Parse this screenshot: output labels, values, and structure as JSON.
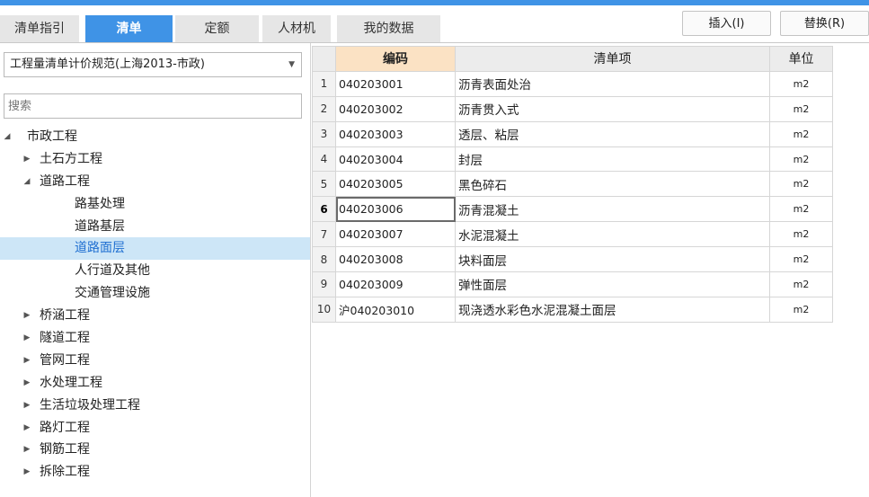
{
  "tabs": [
    "清单指引",
    "清单",
    "定额",
    "人材机",
    "我的数据"
  ],
  "active_tab": "清单",
  "buttons": {
    "insert": "插入(I)",
    "replace": "替换(R)"
  },
  "spec_select": {
    "value": "工程量清单计价规范(上海2013-市政)"
  },
  "search": {
    "placeholder": "搜索"
  },
  "tree": [
    {
      "label": "市政工程",
      "level": 0,
      "state": "expanded"
    },
    {
      "label": "土石方工程",
      "level": 1,
      "state": "collapsed"
    },
    {
      "label": "道路工程",
      "level": 1,
      "state": "expanded"
    },
    {
      "label": "路基处理",
      "level": 2,
      "state": "leaf"
    },
    {
      "label": "道路基层",
      "level": 2,
      "state": "leaf"
    },
    {
      "label": "道路面层",
      "level": 2,
      "state": "leaf",
      "selected": true
    },
    {
      "label": "人行道及其他",
      "level": 2,
      "state": "leaf"
    },
    {
      "label": "交通管理设施",
      "level": 2,
      "state": "leaf"
    },
    {
      "label": "桥涵工程",
      "level": 1,
      "state": "collapsed"
    },
    {
      "label": "隧道工程",
      "level": 1,
      "state": "collapsed"
    },
    {
      "label": "管网工程",
      "level": 1,
      "state": "collapsed"
    },
    {
      "label": "水处理工程",
      "level": 1,
      "state": "collapsed"
    },
    {
      "label": "生活垃圾处理工程",
      "level": 1,
      "state": "collapsed"
    },
    {
      "label": "路灯工程",
      "level": 1,
      "state": "collapsed"
    },
    {
      "label": "钢筋工程",
      "level": 1,
      "state": "collapsed"
    },
    {
      "label": "拆除工程",
      "level": 1,
      "state": "collapsed"
    }
  ],
  "table": {
    "headers": {
      "code": "编码",
      "item": "清单项",
      "unit": "单位"
    },
    "current_row": 6,
    "rows": [
      {
        "no": "1",
        "code": "040203001",
        "item": "沥青表面处治",
        "unit": "m2"
      },
      {
        "no": "2",
        "code": "040203002",
        "item": "沥青贯入式",
        "unit": "m2"
      },
      {
        "no": "3",
        "code": "040203003",
        "item": "透层、粘层",
        "unit": "m2"
      },
      {
        "no": "4",
        "code": "040203004",
        "item": "封层",
        "unit": "m2"
      },
      {
        "no": "5",
        "code": "040203005",
        "item": "黑色碎石",
        "unit": "m2"
      },
      {
        "no": "6",
        "code": "040203006",
        "item": "沥青混凝土",
        "unit": "m2"
      },
      {
        "no": "7",
        "code": "040203007",
        "item": "水泥混凝土",
        "unit": "m2"
      },
      {
        "no": "8",
        "code": "040203008",
        "item": "块料面层",
        "unit": "m2"
      },
      {
        "no": "9",
        "code": "040203009",
        "item": "弹性面层",
        "unit": "m2"
      },
      {
        "no": "10",
        "code": "沪040203010",
        "item": "现浇透水彩色水泥混凝土面层",
        "unit": "m2"
      }
    ]
  },
  "colors": {
    "accent": "#3f93e6",
    "selected_bg": "#cde6f7",
    "header_highlight": "#fbe2c4"
  }
}
